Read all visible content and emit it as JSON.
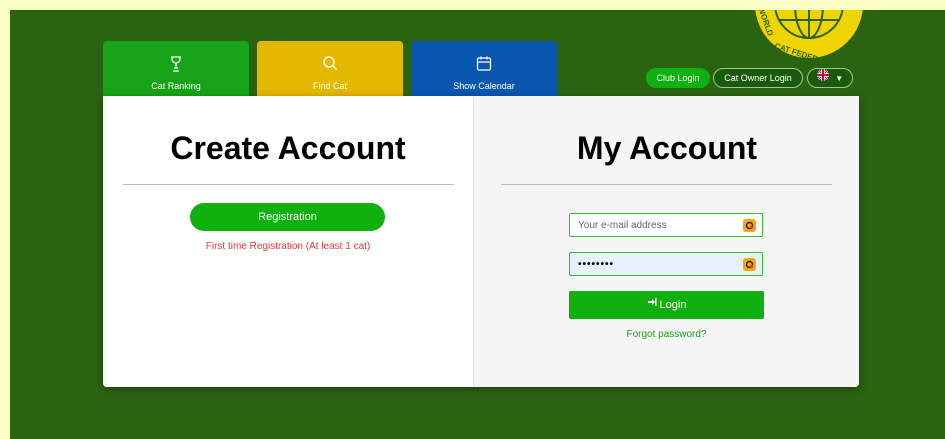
{
  "nav": {
    "ranking": "Cat Ranking",
    "find": "Find Cat",
    "calendar": "Show Calendar"
  },
  "logo_text": "WORLD CAT FEDERATION",
  "top_buttons": {
    "club_login": "Club Login",
    "owner_login": "Cat Owner Login",
    "language_icon": "uk-flag-icon"
  },
  "create": {
    "title": "Create Account",
    "button": "Registration",
    "note": "First time Registration (At least 1 cat)"
  },
  "account": {
    "title": "My Account",
    "email_placeholder": "Your e-mail address",
    "password_value": "••••••••",
    "login_button": "Login",
    "forgot": "Forgot password?"
  },
  "colors": {
    "background_green": "#2a6410",
    "accent_green": "#10b010",
    "gold": "#e5b800",
    "blue": "#0a57b0",
    "error_red": "#e8363b"
  }
}
